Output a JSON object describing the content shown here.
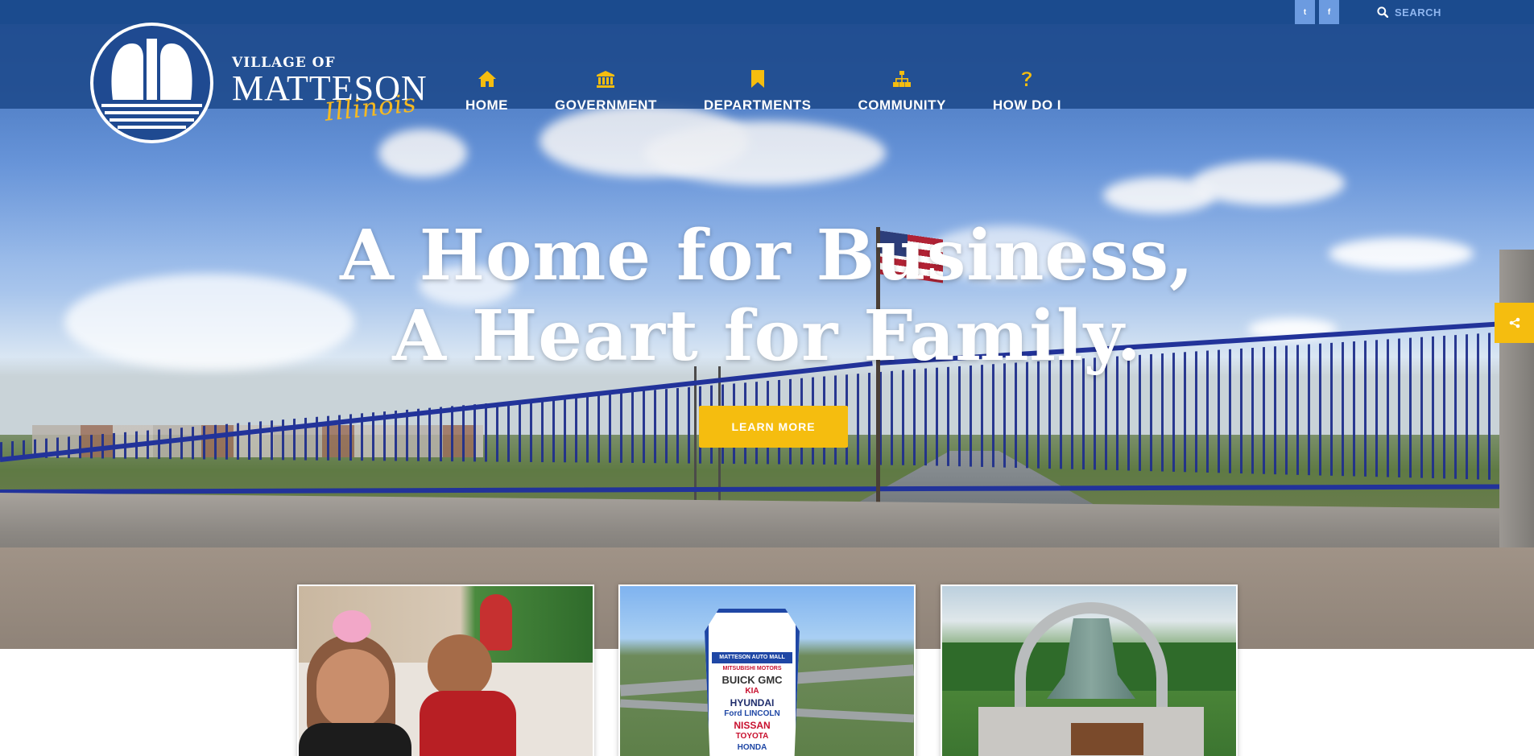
{
  "topbar": {
    "social": [
      {
        "icon": "twitter-icon",
        "glyph": "t"
      },
      {
        "icon": "facebook-icon",
        "glyph": "f"
      }
    ],
    "search_label": "SEARCH"
  },
  "brand": {
    "line1": "VILLAGE OF",
    "line2": "MATTESON",
    "line3": "Illinois"
  },
  "nav": [
    {
      "label": "HOME",
      "icon": "home-icon"
    },
    {
      "label": "GOVERNMENT",
      "icon": "government-building-icon"
    },
    {
      "label": "DEPARTMENTS",
      "icon": "bookmark-icon"
    },
    {
      "label": "COMMUNITY",
      "icon": "sitemap-icon"
    },
    {
      "label": "HOW DO I",
      "icon": "question-icon"
    }
  ],
  "hero": {
    "headline_line1": "A Home for Business,",
    "headline_line2": "A Heart for Family.",
    "cta_label": "LEARN MORE"
  },
  "share": {
    "icon": "share-icon"
  },
  "cards": [
    {
      "name": "children-card",
      "image": "smiling children in classroom"
    },
    {
      "name": "auto-mall-card",
      "image": "auto mall dealership sign",
      "sign_text": [
        "MATTESON AUTO MALL",
        "MITSUBISHI MOTORS",
        "BUICK GMC",
        "KIA",
        "HYUNDAI",
        "Ford LINCOLN",
        "NISSAN",
        "TOYOTA",
        "HONDA"
      ]
    },
    {
      "name": "bell-card",
      "image": "memorial bell monument"
    }
  ],
  "colors": {
    "topbar": "#1b4b8e",
    "navbar": "#1e4a8c",
    "accent": "#f5bd0f",
    "social_button": "#6c9be0"
  }
}
